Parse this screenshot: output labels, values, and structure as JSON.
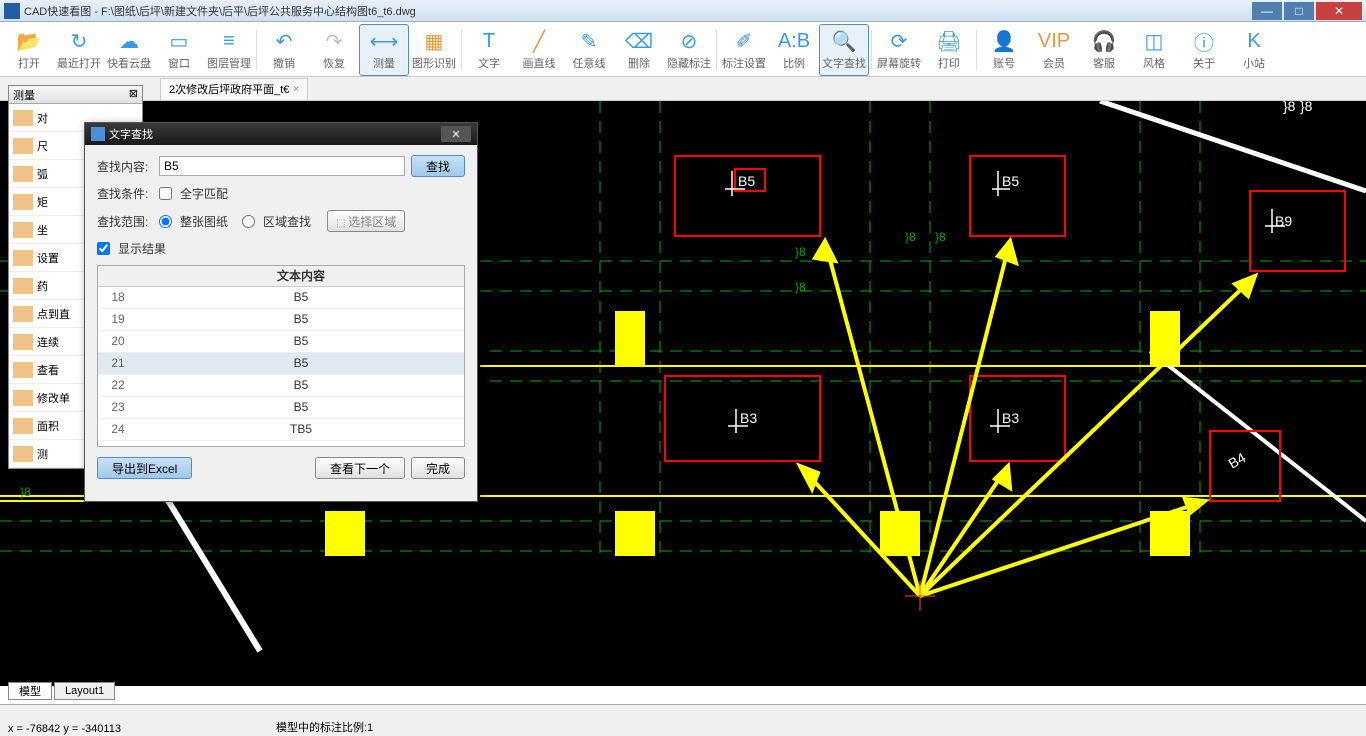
{
  "titlebar": {
    "title": "CAD快速看图 - F:\\图纸\\后坪\\新建文件夹\\后平\\后坪公共服务中心结构图t6_t6.dwg"
  },
  "toolbar": {
    "items": [
      {
        "label": "打开",
        "color": "#3a9ae8",
        "glyph": "📂"
      },
      {
        "label": "最近打开",
        "color": "#3a9ae8",
        "glyph": "↻"
      },
      {
        "label": "快看云盘",
        "color": "#3a9ae8",
        "glyph": "☁"
      },
      {
        "label": "窗口",
        "color": "#3a9ae8",
        "glyph": "▭"
      },
      {
        "label": "图层管理",
        "color": "#3a9ae8",
        "glyph": "≡"
      },
      {
        "sep": true
      },
      {
        "label": "撤销",
        "color": "#3a9ae8",
        "glyph": "↶"
      },
      {
        "label": "恢复",
        "color": "#c0c0c0",
        "glyph": "↷"
      },
      {
        "label": "测量",
        "color": "#3a9ae8",
        "glyph": "⟷",
        "active": true
      },
      {
        "label": "图形识别",
        "color": "#e89a3a",
        "glyph": "▦"
      },
      {
        "sep": true
      },
      {
        "label": "文字",
        "color": "#3a9ae8",
        "glyph": "T"
      },
      {
        "label": "画直线",
        "color": "#e89a3a",
        "glyph": "╱"
      },
      {
        "label": "任意线",
        "color": "#3a9ae8",
        "glyph": "✎"
      },
      {
        "label": "删除",
        "color": "#3a9ae8",
        "glyph": "⌫"
      },
      {
        "label": "隐藏标注",
        "color": "#3a9ae8",
        "glyph": "⊘"
      },
      {
        "sep": true
      },
      {
        "label": "标注设置",
        "color": "#3a9ae8",
        "glyph": "✐"
      },
      {
        "label": "比例",
        "color": "#3a9ae8",
        "glyph": "A:B"
      },
      {
        "label": "文字查找",
        "color": "#3a9ae8",
        "glyph": "🔍",
        "active": true
      },
      {
        "sep": true
      },
      {
        "label": "屏幕旋转",
        "color": "#3a9ae8",
        "glyph": "⟳"
      },
      {
        "label": "打印",
        "color": "#3a9ae8",
        "glyph": "🖨"
      },
      {
        "sep": true
      },
      {
        "label": "账号",
        "color": "#3a9ae8",
        "glyph": "👤"
      },
      {
        "label": "会员",
        "color": "#e89a3a",
        "glyph": "VIP"
      },
      {
        "label": "客服",
        "color": "#3a9ae8",
        "glyph": "🎧"
      },
      {
        "label": "风格",
        "color": "#3a9ae8",
        "glyph": "◫"
      },
      {
        "label": "关于",
        "color": "#3a9ae8",
        "glyph": "ⓘ"
      },
      {
        "label": "小站",
        "color": "#3a9ae8",
        "glyph": "K"
      }
    ]
  },
  "doc_tab": {
    "label": "2次修改后坪政府平面_t€",
    "close": "×"
  },
  "measure_panel": {
    "title": "测量",
    "items": [
      "对",
      "尺",
      "弧",
      "矩",
      "坐",
      "设置",
      "药",
      "点到直",
      "连续",
      "查看",
      "修改单",
      "面积",
      "测"
    ]
  },
  "find_dialog": {
    "title": "文字查找",
    "content_label": "查找内容:",
    "content_value": "B5",
    "search_btn": "查找",
    "condition_label": "查找条件:",
    "full_match": "全字匹配",
    "scope_label": "查找范围:",
    "whole_drawing": "整张图纸",
    "region": "区域查找",
    "select_region": "选择区域",
    "show_results": "显示结果",
    "table_header": "文本内容",
    "rows": [
      {
        "n": "18",
        "t": "B5"
      },
      {
        "n": "19",
        "t": "B5"
      },
      {
        "n": "20",
        "t": "B5"
      },
      {
        "n": "21",
        "t": "B5"
      },
      {
        "n": "22",
        "t": "B5"
      },
      {
        "n": "23",
        "t": "B5"
      },
      {
        "n": "24",
        "t": "TB5"
      }
    ],
    "export_btn": "导出到Excel",
    "next_btn": "查看下一个",
    "done_btn": "完成"
  },
  "canvas_labels": {
    "b5_1": "B5",
    "b5_2": "B5",
    "b9": "B9",
    "b3_1": "B3",
    "b3_2": "B3",
    "b4": "B4",
    "dim8_1": "}8",
    "dim8_2": "}8",
    "dim8_3": "}8",
    "dim8_4": "}8",
    "dim8_5": "}8",
    "dim8_6": "}8"
  },
  "bottom_tabs": {
    "model": "模型",
    "layout": "Layout1"
  },
  "statusbar": {
    "coords": "x = -76842  y = -340113",
    "scale": "模型中的标注比例:1"
  }
}
